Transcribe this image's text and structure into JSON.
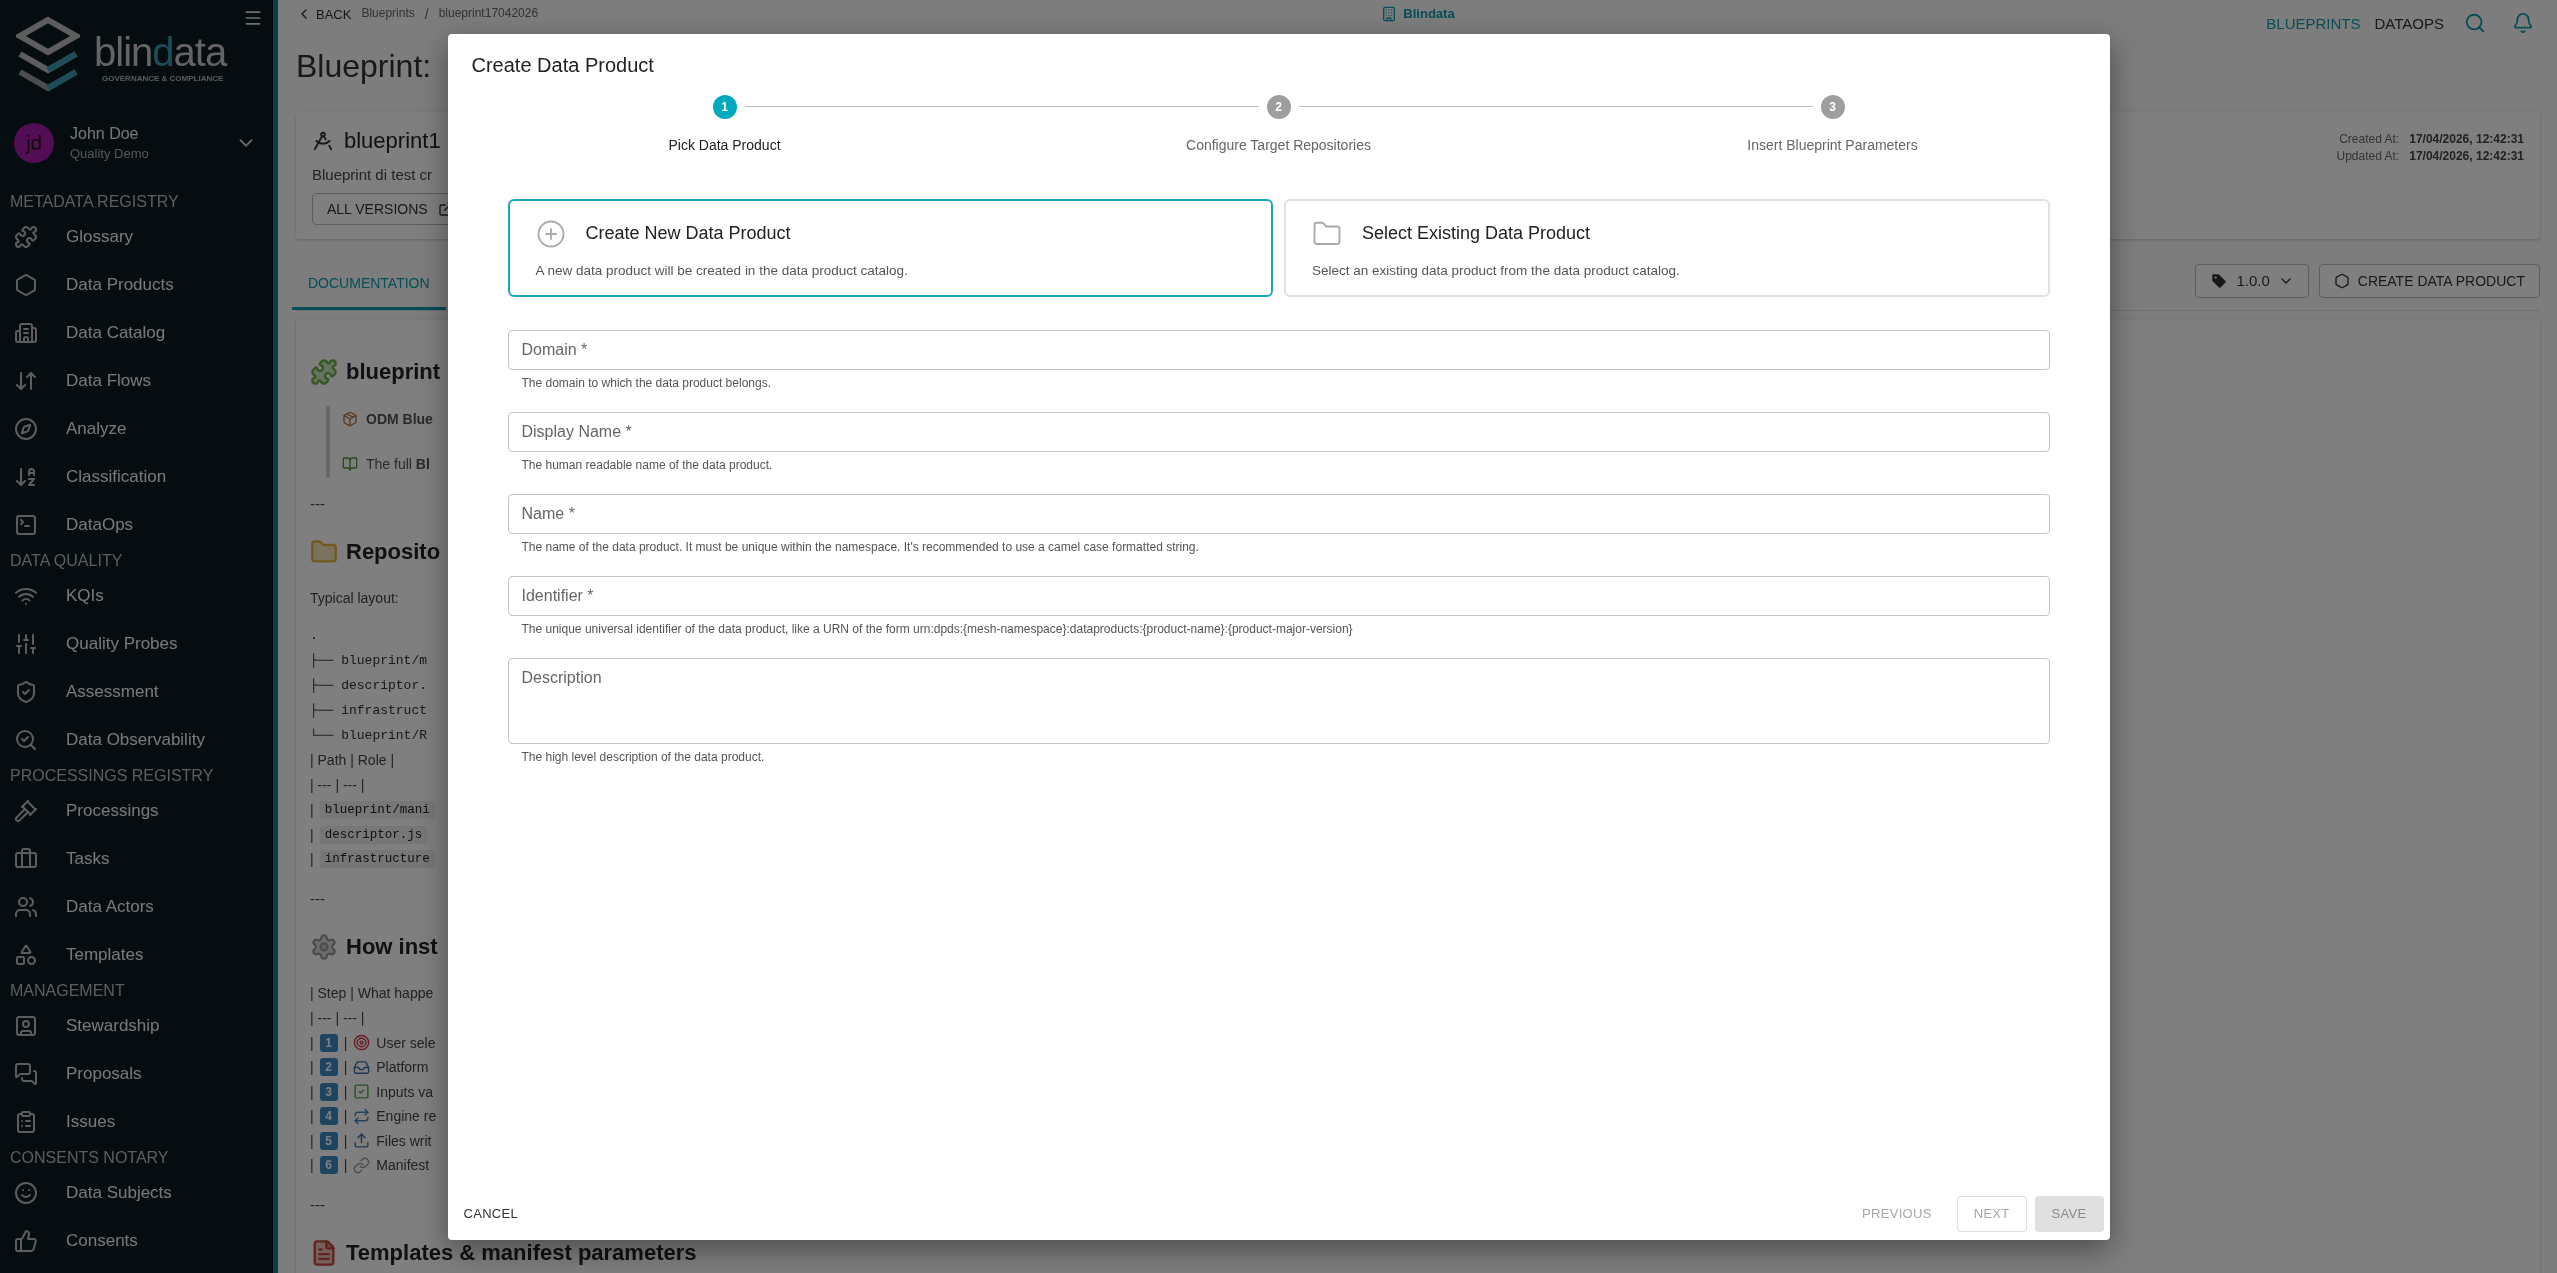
{
  "sidebar": {
    "logo": {
      "parts": [
        {
          "text": "blin",
          "accent": false
        },
        {
          "text": "d",
          "accent": true
        },
        {
          "text": "ata",
          "accent": false
        }
      ],
      "tagline": "GOVERNANCE & COMPLIANCE"
    },
    "user": {
      "initials": "jd",
      "name": "John Doe",
      "role": "Quality Demo"
    },
    "sections": [
      {
        "title": "METADATA REGISTRY",
        "items": [
          {
            "label": "Glossary"
          },
          {
            "label": "Data Products"
          },
          {
            "label": "Data Catalog"
          },
          {
            "label": "Data Flows"
          },
          {
            "label": "Analyze"
          },
          {
            "label": "Classification"
          },
          {
            "label": "DataOps"
          }
        ]
      },
      {
        "title": "DATA QUALITY",
        "items": [
          {
            "label": "KQIs"
          },
          {
            "label": "Quality Probes"
          },
          {
            "label": "Assessment"
          },
          {
            "label": "Data Observability"
          }
        ]
      },
      {
        "title": "PROCESSINGS REGISTRY",
        "items": [
          {
            "label": "Processings"
          },
          {
            "label": "Tasks"
          },
          {
            "label": "Data Actors"
          },
          {
            "label": "Templates"
          }
        ]
      },
      {
        "title": "MANAGEMENT",
        "items": [
          {
            "label": "Stewardship"
          },
          {
            "label": "Proposals"
          },
          {
            "label": "Issues"
          }
        ]
      },
      {
        "title": "CONSENTS NOTARY",
        "items": [
          {
            "label": "Data Subjects"
          },
          {
            "label": "Consents"
          }
        ]
      }
    ]
  },
  "topbar": {
    "back": "BACK",
    "breadcrumbs": [
      "Blueprints",
      "/",
      "blueprint17042026"
    ],
    "center_label": "Blindata",
    "nav": [
      {
        "label": "BLUEPRINTS",
        "selected": true
      },
      {
        "label": "DATAOPS",
        "selected": false
      }
    ]
  },
  "page": {
    "title": "Blueprint:",
    "card": {
      "name": "blueprint1",
      "description": "Blueprint di test cr",
      "versions_button": "ALL VERSIONS",
      "meta": [
        {
          "label": "Created At:",
          "value": "17/04/2026, 12:42:31"
        },
        {
          "label": "Updated At:",
          "value": "17/04/2026, 12:42:31"
        }
      ]
    },
    "tabs": [
      {
        "label": "DOCUMENTATION",
        "selected": true
      }
    ],
    "version_select": "1.0.0",
    "create_button": "CREATE DATA PRODUCT",
    "doc": [
      {
        "kind": "heading",
        "text": "blueprint"
      },
      {
        "kind": "quote",
        "lines": [
          "**ODM Blue**",
          "The full **Bl**"
        ]
      },
      {
        "kind": "rule",
        "text": "---"
      },
      {
        "kind": "heading",
        "text": "Reposito"
      },
      {
        "kind": "paragraph",
        "text": "Typical layout:"
      },
      {
        "kind": "code",
        "lines": [
          ".",
          "├── blueprint/m",
          "├── descriptor.",
          "├── infrastruct",
          "└── blueprint/R"
        ]
      },
      {
        "kind": "paragraph",
        "text": "| Path | Role |"
      },
      {
        "kind": "paragraph",
        "text": "| --- | --- |"
      },
      {
        "kind": "code_row",
        "lead": "|",
        "code": "blueprint/mani"
      },
      {
        "kind": "code_row",
        "lead": "|",
        "code": "descriptor.js"
      },
      {
        "kind": "code_row",
        "lead": "|",
        "code": "infrastructure"
      },
      {
        "kind": "rule",
        "text": "---"
      },
      {
        "kind": "heading",
        "text": "How inst"
      },
      {
        "kind": "paragraph",
        "text": "| Step | What happe"
      },
      {
        "kind": "paragraph",
        "text": "| --- | --- |"
      },
      {
        "kind": "step_row",
        "lead": "|",
        "number": "1",
        "sep": "|",
        "text": "User sele"
      },
      {
        "kind": "step_row",
        "lead": "|",
        "number": "2",
        "sep": "|",
        "text": "Platform"
      },
      {
        "kind": "step_row",
        "lead": "|",
        "number": "3",
        "sep": "|",
        "text": "Inputs va"
      },
      {
        "kind": "step_row",
        "lead": "|",
        "number": "4",
        "sep": "|",
        "text": "Engine re"
      },
      {
        "kind": "step_row",
        "lead": "|",
        "number": "5",
        "sep": "|",
        "text": "Files writ"
      },
      {
        "kind": "step_row",
        "lead": "|",
        "number": "6",
        "sep": "|",
        "text": "Manifest"
      },
      {
        "kind": "rule",
        "text": "---"
      },
      {
        "kind": "heading",
        "text": "Templates & manifest parameters"
      }
    ]
  },
  "dialog": {
    "title": "Create Data Product",
    "steps": [
      {
        "number": "1",
        "label": "Pick Data Product",
        "selected": true
      },
      {
        "number": "2",
        "label": "Configure Target Repositories",
        "selected": false
      },
      {
        "number": "3",
        "label": "Insert Blueprint Parameters",
        "selected": false
      }
    ],
    "options": [
      {
        "title": "Create New Data Product",
        "description": "A new data product will be created in the data product catalog.",
        "selected": true
      },
      {
        "title": "Select Existing Data Product",
        "description": "Select an existing data product from the data product catalog.",
        "selected": false
      }
    ],
    "fields": [
      {
        "kind": "input",
        "placeholder": "Domain *",
        "helper": "The domain to which the data product belongs."
      },
      {
        "kind": "input",
        "placeholder": "Display Name *",
        "helper": "The human readable name of the data product."
      },
      {
        "kind": "input",
        "placeholder": "Name *",
        "helper": "The name of the data product. It must be unique within the namespace. It's recommended to use a camel case formatted string."
      },
      {
        "kind": "input",
        "placeholder": "Identifier *",
        "helper": "The unique universal identifier of the data product, like a URN of the form urn:dpds:{mesh-namespace}:dataproducts:{product-name}:{product-major-version}"
      },
      {
        "kind": "textarea",
        "placeholder": "Description",
        "helper": "The high level description of the data product."
      }
    ],
    "footer": {
      "cancel": "CANCEL",
      "buttons": [
        {
          "kind": "text",
          "label": "PREVIOUS",
          "disabled": true
        },
        {
          "kind": "outlined",
          "label": "NEXT",
          "disabled": true
        },
        {
          "kind": "contained",
          "label": "SAVE",
          "disabled": true
        }
      ]
    }
  }
}
